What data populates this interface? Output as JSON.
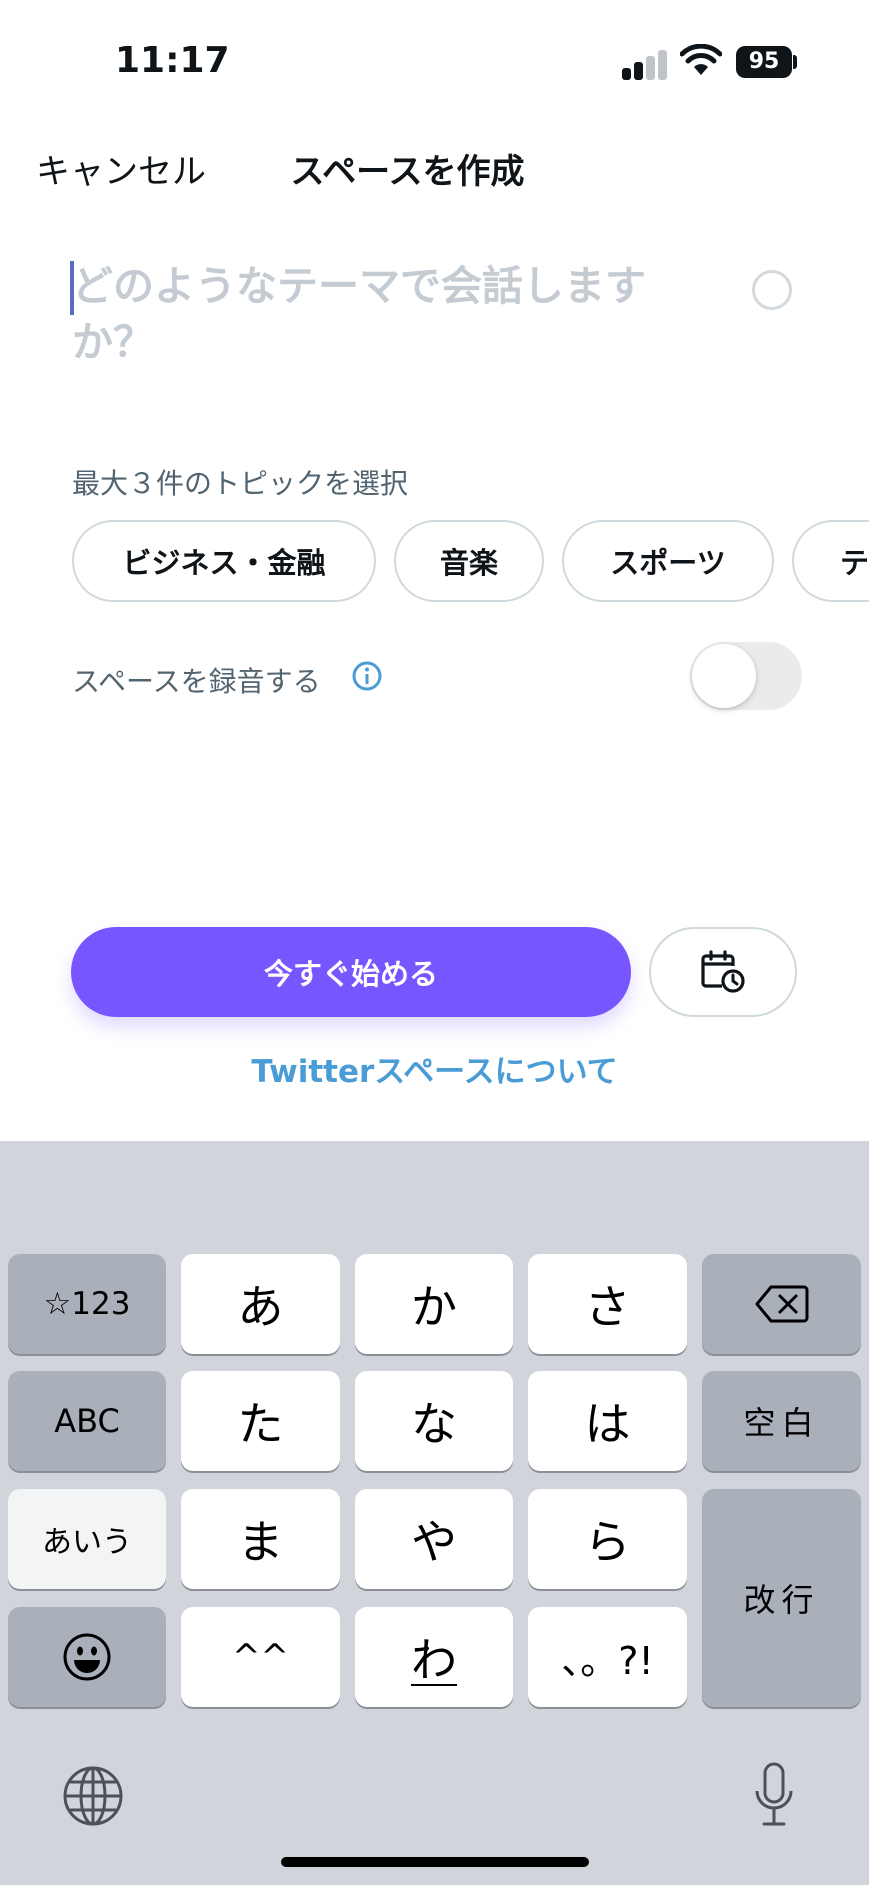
{
  "status_bar": {
    "time": "11:17",
    "battery": "95"
  },
  "header": {
    "cancel_label": "キャンセル",
    "title": "スペースを作成"
  },
  "prompt": {
    "placeholder": "どのようなテーマで会話しますか？"
  },
  "topics": {
    "label": "最大３件のトピックを選択",
    "chips": [
      "ビジネス・金融",
      "音楽",
      "スポーツ",
      "テ"
    ]
  },
  "record": {
    "label": "スペースを録音する",
    "enabled": false
  },
  "actions": {
    "start_label": "今すぐ始める",
    "about_link": "Twitterスペースについて"
  },
  "colors": {
    "accent": "#7856ff",
    "link": "#4a9cd6"
  },
  "keyboard": {
    "rows": [
      [
        "☆123",
        "あ",
        "か",
        "さ",
        "delete"
      ],
      [
        "ABC",
        "た",
        "な",
        "は",
        "空白"
      ],
      [
        "あいう",
        "ま",
        "や",
        "ら",
        "改行"
      ],
      [
        "emoji",
        "^^",
        "わ",
        "、。?!"
      ]
    ],
    "icons": [
      "delete-icon",
      "emoji-icon",
      "globe-icon",
      "microphone-icon"
    ]
  }
}
